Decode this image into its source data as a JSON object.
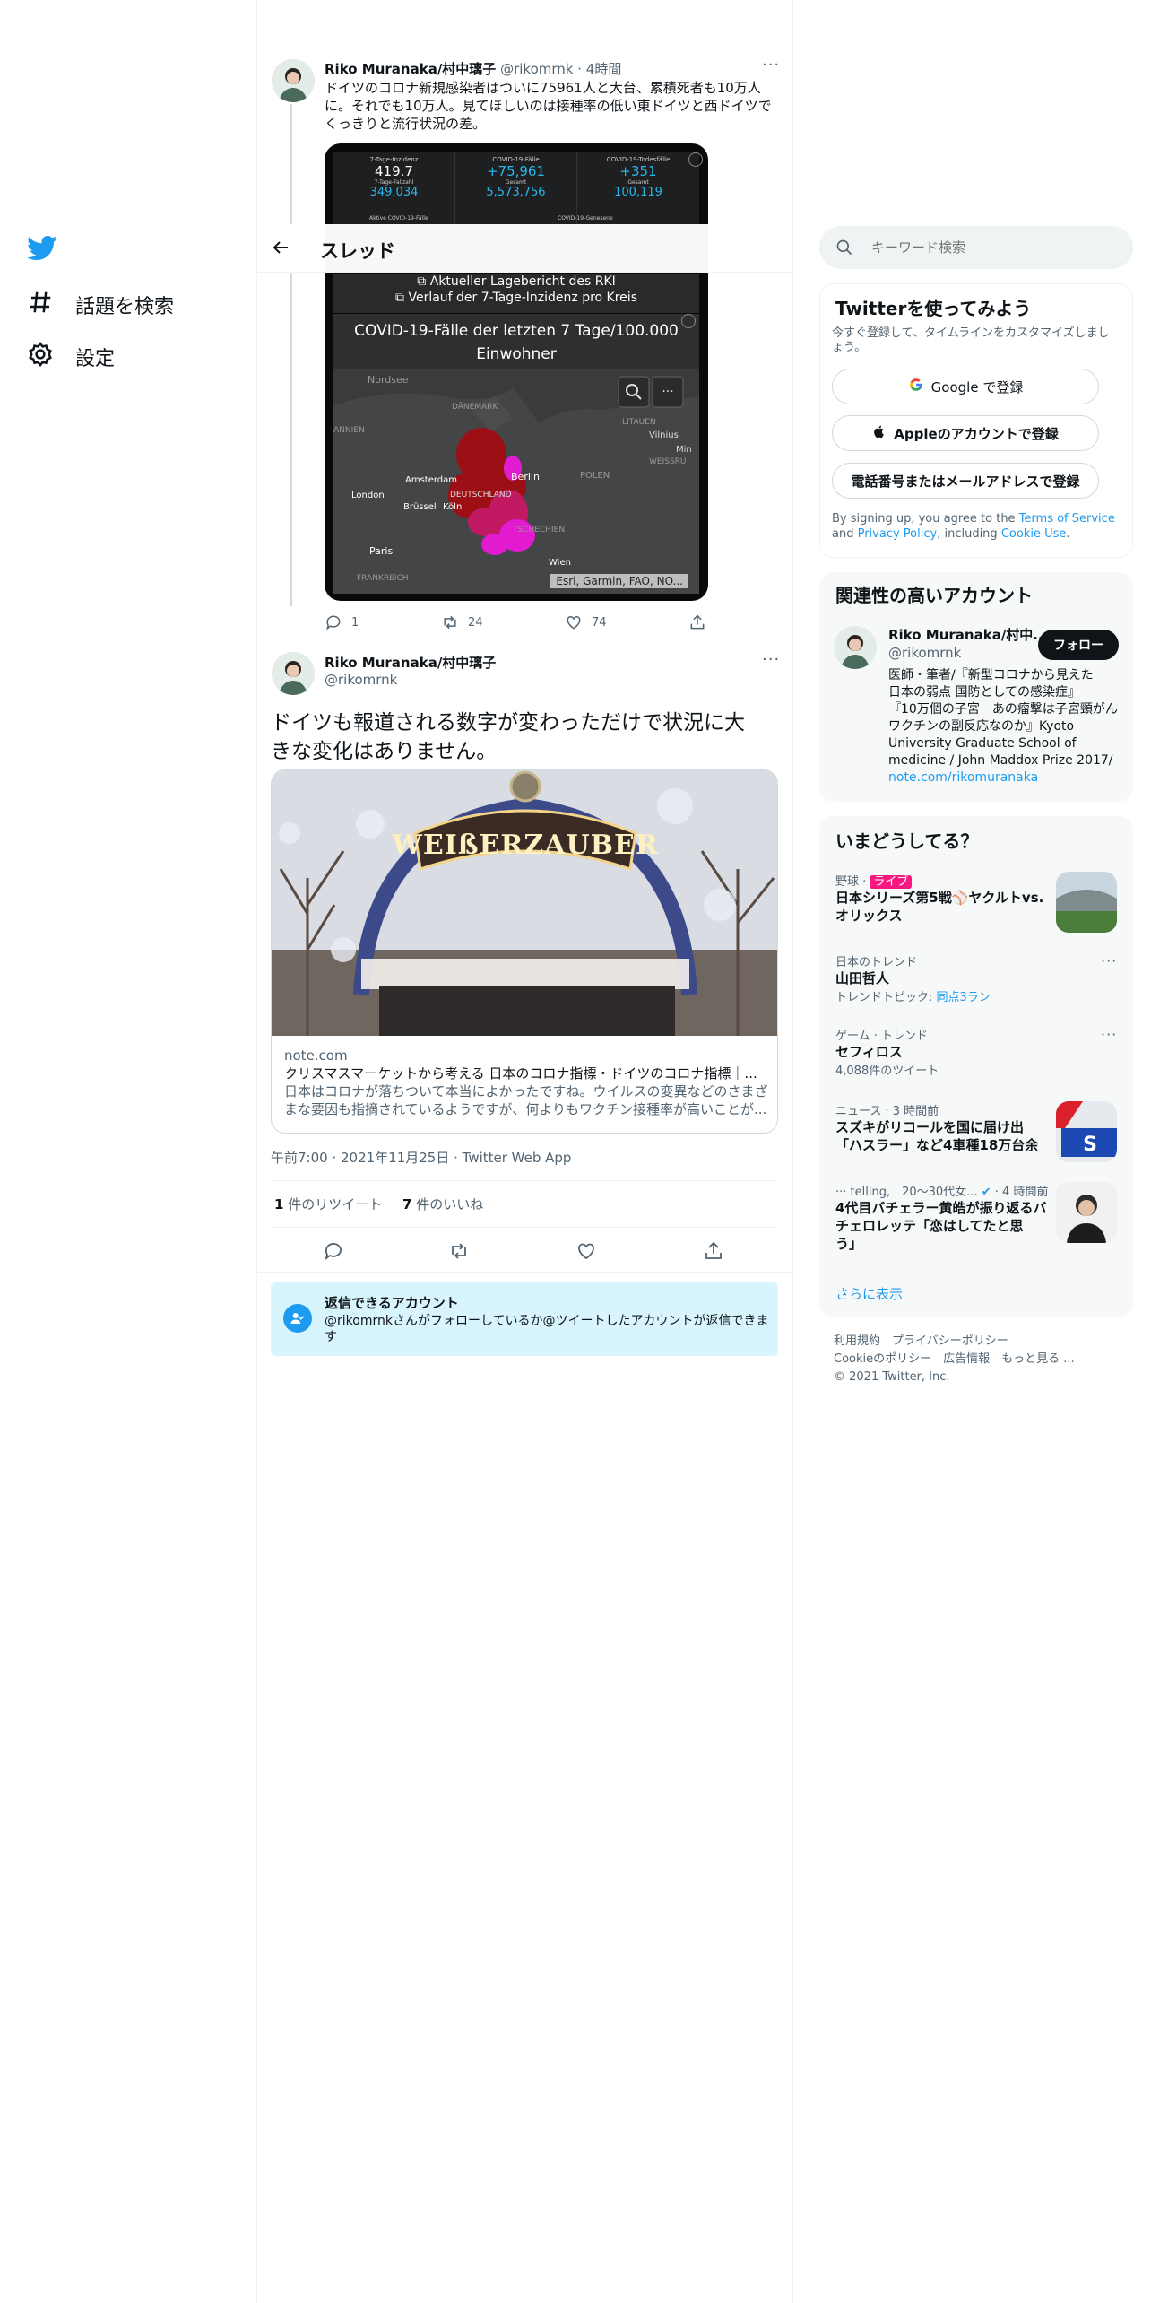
{
  "nav": {
    "items": [
      {
        "label": "話題を検索",
        "icon": "hashtag-icon"
      },
      {
        "label": "設定",
        "icon": "gear-icon"
      }
    ]
  },
  "header": {
    "title": "スレッド"
  },
  "search": {
    "placeholder": "キーワード検索"
  },
  "previous_tweet": {
    "name": "Riko Muranaka/村中璃子",
    "handle": "@rikomrnk",
    "time": "4時間",
    "text": "ドイツのコロナ新規感染者はついに75961人と大台、累積死者も10万人に。それでも10万人。見てほしいのは接種率の低い東ドイツと西ドイツでくっきりと流行状況の差。",
    "dashboard": {
      "cells": [
        {
          "label": "7-Tage-Inzidenz",
          "value": "419.7",
          "sub_label": "7-Tage-Fallzahl",
          "sub_value": "349,034"
        },
        {
          "label": "COVID-19-Fälle",
          "value": "+75,961",
          "sub_label": "Gesamt",
          "sub_value": "5,573,756"
        },
        {
          "label": "COVID-19-Todesfälle",
          "value": "+351",
          "sub_label": "Gesamt",
          "sub_value": "100,119"
        }
      ],
      "row2_labels": [
        "Aktive COVID-19-Fälle",
        "COVID-19-Genesene"
      ],
      "link1": "Aktueller Lagebericht des RKI",
      "link2": "Verlauf der 7-Tage-Inzidenz pro Kreis"
    },
    "map": {
      "title_line1": "COVID-19-Fälle der letzten 7 Tage/100.000",
      "title_line2": "Einwohner",
      "labels": [
        {
          "text": "Nordsee"
        },
        {
          "text": "DÄNEMARK"
        },
        {
          "text": "LITAUEN"
        },
        {
          "text": "Vilnius"
        },
        {
          "text": "Min"
        },
        {
          "text": "WEISSRU"
        },
        {
          "text": "ANNIEN"
        },
        {
          "text": "Amsterdam"
        },
        {
          "text": "Berlin"
        },
        {
          "text": "POLEN"
        },
        {
          "text": "London"
        },
        {
          "text": "Brüssel"
        },
        {
          "text": "DEUTSCHLAND"
        },
        {
          "text": "Köln"
        },
        {
          "text": "TSCHECHIEN"
        },
        {
          "text": "Paris"
        },
        {
          "text": "Wien"
        },
        {
          "text": "FRANKREICH"
        }
      ],
      "attribution": "Esri, Garmin, FAO, NO..."
    },
    "reply_count": "1",
    "retweet_count": "24",
    "like_count": "74"
  },
  "main_tweet": {
    "name": "Riko Muranaka/村中璃子",
    "handle": "@rikomrnk",
    "text_line1": "ドイツも報道される数字が変わっただけで状況に大",
    "text_line2": "きな変化はありません。",
    "image_sign": "WEIßERZAUBER",
    "card": {
      "domain": "note.com",
      "title": "クリスマスマーケットから考える 日本のコロナ指標・ドイツのコロナ指標｜...",
      "desc_line1": "日本はコロナが落ちついて本当によかったですね。ウイルスの変異などのさまざ",
      "desc_line2": "まな要因も指摘されているようですが、何よりもワクチン接種率が高いことが..."
    },
    "timestamp": "午前7:00 · 2021年11月25日 · Twitter Web App",
    "retweets_num": "1",
    "retweets_label": "件のリツイート",
    "likes_num": "7",
    "likes_label": "件のいいね"
  },
  "reply_notice": {
    "title": "返信できるアカウント",
    "line1": "@rikomrnkさんがフォローしているか@ツイートしたアカウントが返信できま",
    "line2": "す"
  },
  "signup": {
    "title": "Twitterを使ってみよう",
    "subtitle_line1": "今すぐ登録して、タイムラインをカスタマイズしまし",
    "subtitle_line2": "ょう。",
    "google_label": "Google で登録",
    "apple_label": "Appleのアカウントで登録",
    "phone_label": "電話番号またはメールアドレスで登録",
    "legal_1": "By signing up, you agree to the ",
    "terms": "Terms of Service",
    "legal_2": " and ",
    "privacy": "Privacy Policy",
    "legal_3": ", including ",
    "cookie": "Cookie Use",
    "legal_4": "."
  },
  "related": {
    "title": "関連性の高いアカウント",
    "name": "Riko Muranaka/村中...",
    "handle": "@rikomrnk",
    "follow_label": "フォロー",
    "bio_lines": [
      "医師・筆者/『新型コロナから見えた",
      "日本の弱点 国防としての感染症』",
      "『10万個の子宮　あの瘤撃は子宮頸がん",
      "ワクチンの副反応なのか』Kyoto",
      "University Graduate School of",
      "medicine / John Maddox Prize 2017/"
    ],
    "bio_link": "note.com/rikomuranaka"
  },
  "trends": {
    "title": "いまどうしてる？",
    "items": [
      {
        "meta": "野球 · ",
        "badge": "ライブ",
        "title_line1": "日本シリーズ第5戦⚾ヤクルトvs.",
        "title_line2": "オリックス"
      },
      {
        "meta": "日本のトレンド",
        "title_line1": "山田哲人",
        "sub_prefix": "トレンドトピック: ",
        "sub_link": "同点3ラン"
      },
      {
        "meta": "ゲーム · トレンド",
        "title_line1": "セフィロス",
        "sub": "4,088件のツイート"
      },
      {
        "meta": "ニュース · 3 時間前",
        "title_line1": "スズキがリコールを国に届け出",
        "title_line2": "「ハスラー」など4車種18万台余"
      },
      {
        "meta_name": "telling,｜20～30代女...",
        "meta_time": " · 4 時間前",
        "title_line1": "4代目バチェラー黄皓が振り返るバ",
        "title_line2": "チェロレッテ「恋はしてたと思",
        "title_line3": "う」"
      }
    ],
    "show_more": "さらに表示"
  },
  "footer": {
    "line1": "利用規約　プライバシーポリシー",
    "line2": "Cookieのポリシー　広告情報　もっと見る ...",
    "line3": "© 2021 Twitter, Inc."
  },
  "colors": {
    "accent": "#1d9bf0",
    "text": "#0f1419",
    "muted": "#536471",
    "live_badge": "#f91880",
    "notice_bg": "#d8f5fd"
  }
}
